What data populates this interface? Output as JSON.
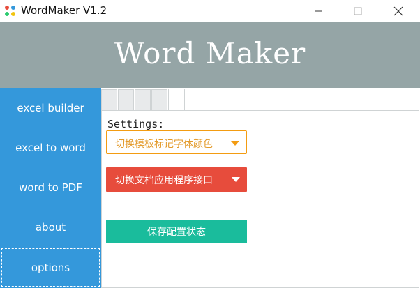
{
  "window": {
    "title": "WordMaker V1.2",
    "icon": "app-dots-icon",
    "controls": [
      "minimize-icon",
      "maximize-icon",
      "close-icon"
    ]
  },
  "banner": {
    "title": "Word Maker",
    "background": "#95a5a6"
  },
  "sidebar": {
    "background": "#3498db",
    "items": [
      {
        "label": "excel builder"
      },
      {
        "label": "excel to word"
      },
      {
        "label": "word to PDF"
      },
      {
        "label": "about"
      },
      {
        "label": "options",
        "active": true
      }
    ]
  },
  "settings": {
    "label": "Settings:",
    "template_dropdown": {
      "value": "切换模板标记字体颜色",
      "color": "#f39c12"
    },
    "api_dropdown": {
      "value": "切换文档应用程序接口",
      "color": "#e74c3c"
    },
    "save_button": {
      "label": "保存配置状态",
      "color": "#1abc9c"
    }
  }
}
